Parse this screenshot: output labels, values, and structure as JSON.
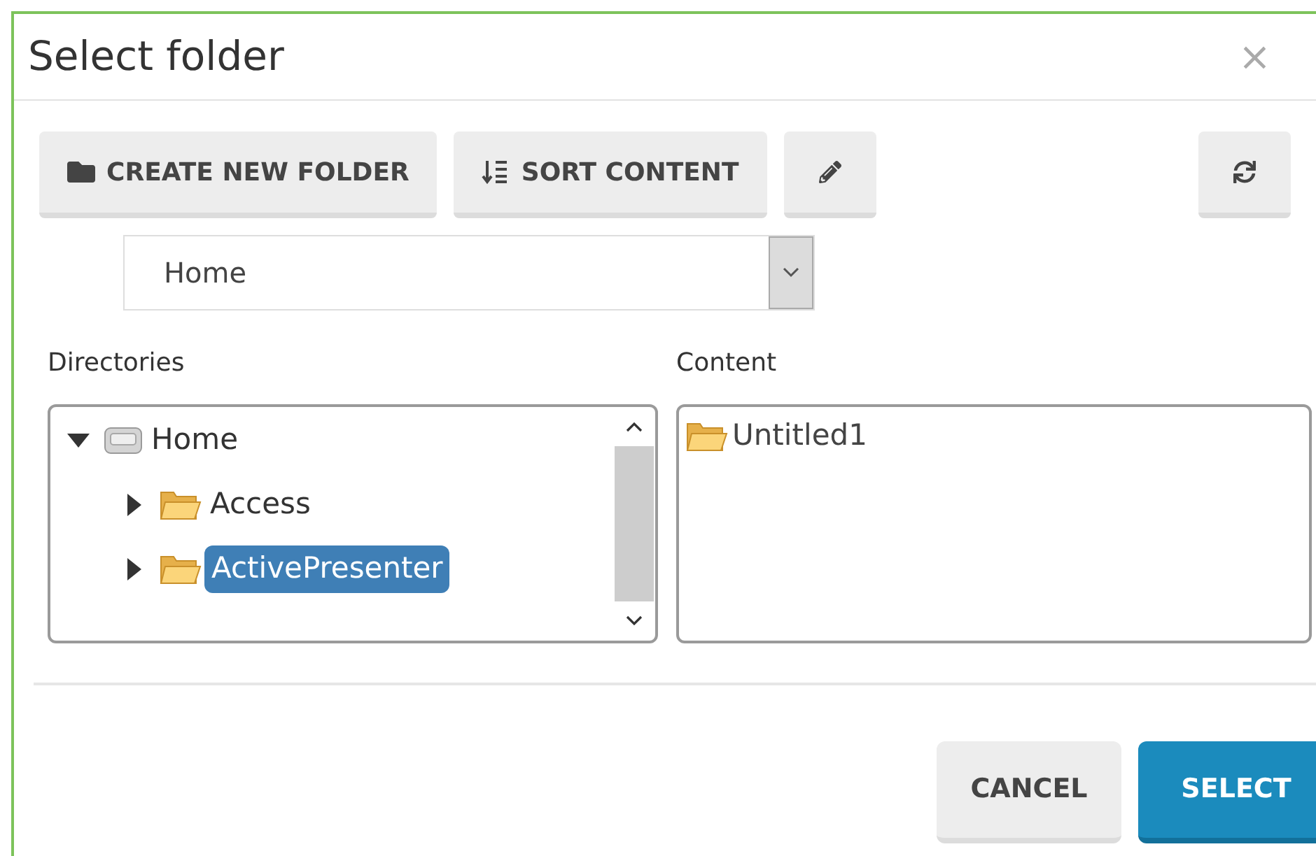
{
  "dialog": {
    "title": "Select folder",
    "close": "×"
  },
  "toolbar": [
    {
      "kind": "create",
      "label": "CREATE NEW FOLDER"
    },
    {
      "kind": "sort",
      "label": "SORT CONTENT"
    },
    {
      "kind": "edit"
    },
    {
      "kind": "refresh"
    }
  ],
  "location": {
    "value": "Home"
  },
  "directories": {
    "label": "Directories",
    "tree": [
      {
        "kind": "drive",
        "label": "Home",
        "expanded": true,
        "selected": false,
        "children": [
          {
            "kind": "folder",
            "label": "Access",
            "expanded": false,
            "selected": false
          },
          {
            "kind": "folder",
            "label": "ActivePresenter",
            "expanded": false,
            "selected": true
          }
        ]
      }
    ]
  },
  "content": {
    "label": "Content",
    "items": [
      {
        "kind": "folder",
        "label": "Untitled1"
      }
    ]
  },
  "buttons": [
    {
      "kind": "secondary",
      "label": "CANCEL"
    },
    {
      "kind": "primary",
      "label": "SELECT"
    }
  ]
}
